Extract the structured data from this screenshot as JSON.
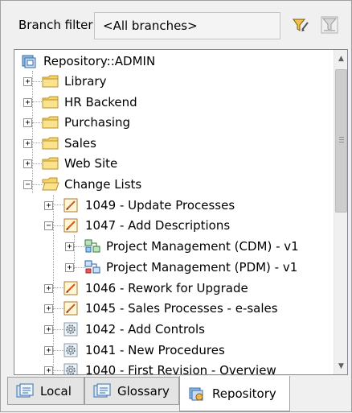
{
  "filter": {
    "label": "Branch filter:",
    "value": "<All branches>",
    "filter_icon": "filter-funnel-icon",
    "clear_icon": "clear-filter-icon"
  },
  "tree": {
    "items": [
      {
        "label": "Repository::ADMIN",
        "icon": "repository-icon",
        "expander": ""
      },
      {
        "label": "Library",
        "icon": "folder-icon",
        "expander": "+"
      },
      {
        "label": "HR Backend",
        "icon": "folder-icon",
        "expander": "+"
      },
      {
        "label": "Purchasing",
        "icon": "folder-icon",
        "expander": "+"
      },
      {
        "label": "Sales",
        "icon": "folder-icon",
        "expander": "+"
      },
      {
        "label": "Web Site",
        "icon": "folder-icon",
        "expander": "+"
      },
      {
        "label": "Change Lists",
        "icon": "open-folder-icon",
        "expander": "−"
      },
      {
        "label": "1049 - Update Processes",
        "icon": "change-list-icon",
        "expander": "+"
      },
      {
        "label": "1047 - Add Descriptions",
        "icon": "change-list-icon",
        "expander": "−"
      },
      {
        "label": "Project Management (CDM) - v1",
        "icon": "cdm-model-icon",
        "expander": "+"
      },
      {
        "label": "Project Management (PDM) - v1",
        "icon": "pdm-model-icon",
        "expander": "+"
      },
      {
        "label": "1046 - Rework for Upgrade",
        "icon": "change-list-icon",
        "expander": "+"
      },
      {
        "label": "1045 - Sales Processes - e-sales",
        "icon": "change-list-icon",
        "expander": "+"
      },
      {
        "label": "1042 - Add Controls",
        "icon": "gear-icon",
        "expander": "+"
      },
      {
        "label": "1041 - New Procedures",
        "icon": "gear-icon",
        "expander": "+"
      },
      {
        "label": "1040 - First Revision - Overview",
        "icon": "gear-icon",
        "expander": "+"
      }
    ]
  },
  "tabs": [
    {
      "label": "Local",
      "icon": "local-tab-icon",
      "active": false
    },
    {
      "label": "Glossary",
      "icon": "glossary-tab-icon",
      "active": false
    },
    {
      "label": "Repository",
      "icon": "repository-tab-icon",
      "active": true
    }
  ],
  "colors": {
    "folder": "#f6d46a",
    "folder_border": "#b8922c",
    "accent_blue": "#3a7fc8"
  }
}
